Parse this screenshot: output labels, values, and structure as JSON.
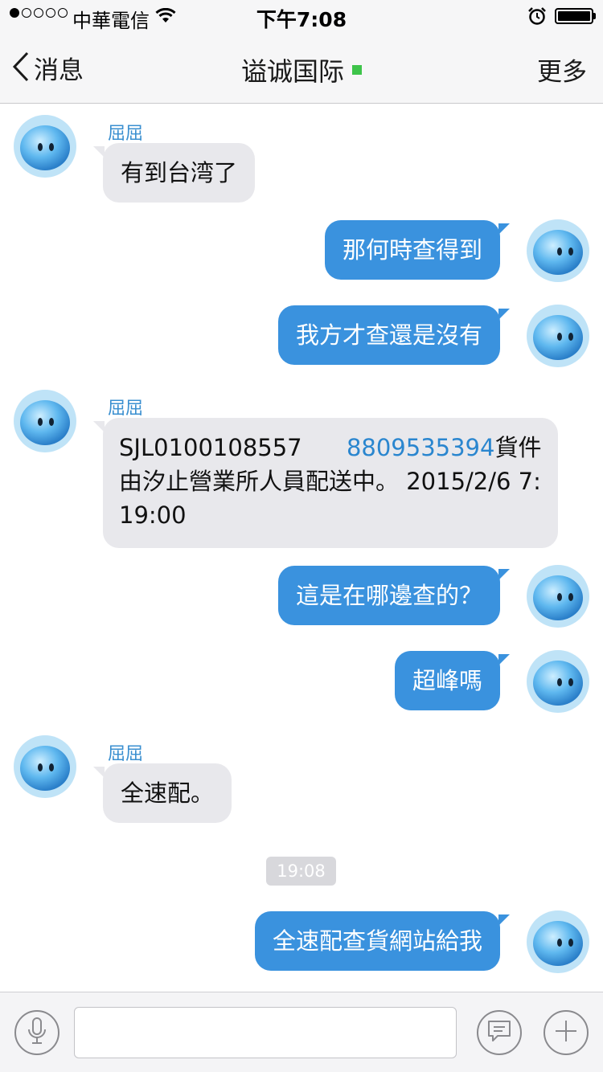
{
  "status_bar": {
    "carrier": "中華電信",
    "time": "下午7:08",
    "signal_dots_filled": 1,
    "signal_dots_total": 5
  },
  "nav": {
    "back_label": "消息",
    "title": "谥诚国际",
    "more_label": "更多",
    "online_color": "#3ec44a"
  },
  "messages": [
    {
      "direction": "in",
      "sender": "屈屈",
      "text": "有到台湾了"
    },
    {
      "direction": "out",
      "text": "那何時查得到"
    },
    {
      "direction": "out",
      "text": "我方才查還是沒有"
    },
    {
      "direction": "in",
      "sender": "屈屈",
      "text_part1": "SJL0100108557",
      "link": "8809535394",
      "text_part2": "貨件由汐止營業所人員配送中。 2015/2/6 7:19:00"
    },
    {
      "direction": "out",
      "text": "這是在哪邊查的？"
    },
    {
      "direction": "out",
      "text": "超峰嗎"
    },
    {
      "direction": "in",
      "sender": "屈屈",
      "text": "全速配。"
    },
    {
      "direction": "out",
      "text": "全速配查貨網站給我"
    }
  ],
  "timestamp": "19:08",
  "input_bar": {
    "placeholder": "",
    "value": ""
  },
  "colors": {
    "outgoing_bubble": "#3a92de",
    "incoming_bubble": "#e8e8ec",
    "sender_name": "#3a8fd0",
    "link": "#2a86cf"
  },
  "icons": [
    "back-chevron-icon",
    "wifi-icon",
    "alarm-icon",
    "battery-icon",
    "microphone-icon",
    "emoji-chat-icon",
    "plus-icon",
    "qq-avatar-icon"
  ]
}
